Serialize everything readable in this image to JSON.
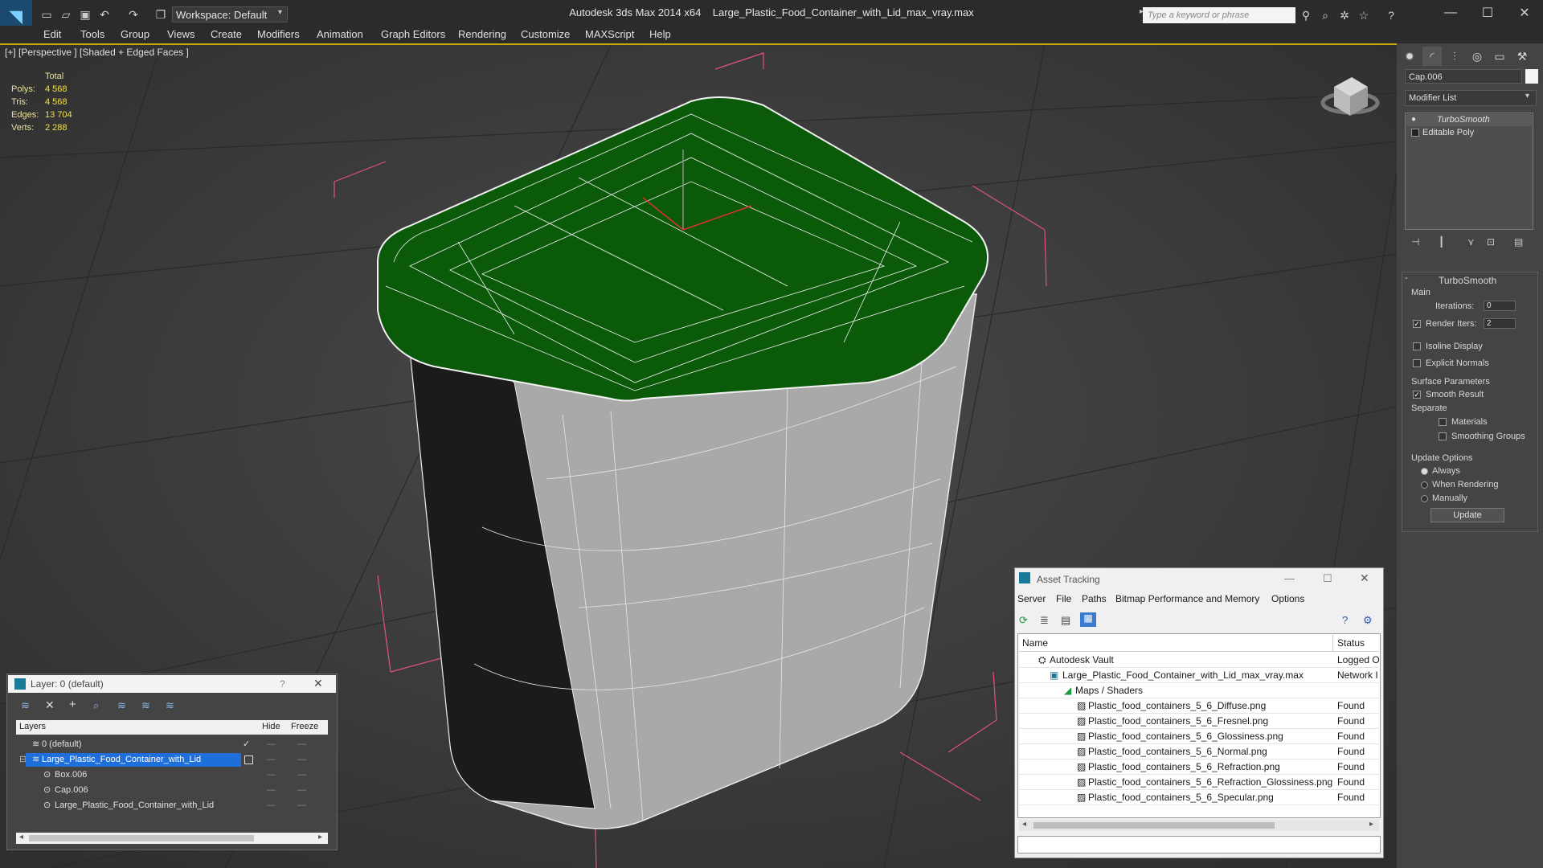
{
  "titlebar": {
    "app": "Autodesk 3ds Max  2014 x64",
    "file": "Large_Plastic_Food_Container_with_Lid_max_vray.max",
    "workspace": "Workspace: Default",
    "search_placeholder": "Type a keyword or phrase"
  },
  "menu": [
    "Edit",
    "Tools",
    "Group",
    "Views",
    "Create",
    "Modifiers",
    "Animation",
    "Graph Editors",
    "Rendering",
    "Customize",
    "MAXScript",
    "Help"
  ],
  "viewport": {
    "label": "[+] [Perspective ] [Shaded + Edged Faces ]",
    "stats": {
      "header": "Total",
      "rows": [
        {
          "label": "Polys:",
          "value": "4 568"
        },
        {
          "label": "Tris:",
          "value": "4 568"
        },
        {
          "label": "Edges:",
          "value": "13 704"
        },
        {
          "label": "Verts:",
          "value": "2 288"
        }
      ]
    }
  },
  "command_panel": {
    "object_name": "Cap.006",
    "modifier_list": "Modifier List",
    "stack": [
      "TurboSmooth",
      "Editable Poly"
    ],
    "rollout_title": "TurboSmooth",
    "main_group": "Main",
    "iterations_label": "Iterations:",
    "iterations_value": "0",
    "render_iters_label": "Render Iters:",
    "render_iters_value": "2",
    "isoline": "Isoline Display",
    "explicit_normals": "Explicit Normals",
    "surface_group": "Surface Parameters",
    "smooth_result": "Smooth Result",
    "separate": "Separate",
    "materials": "Materials",
    "smoothing_groups": "Smoothing Groups",
    "update_group": "Update Options",
    "always": "Always",
    "when_rendering": "When Rendering",
    "manually": "Manually",
    "update": "Update"
  },
  "asset_tracking": {
    "title": "Asset Tracking",
    "menu": [
      "Server",
      "File",
      "Paths",
      "Bitmap Performance and Memory",
      "Options"
    ],
    "columns": {
      "name": "Name",
      "status": "Status"
    },
    "rows": [
      {
        "name": "Autodesk Vault",
        "status": "Logged O"
      },
      {
        "name": "Large_Plastic_Food_Container_with_Lid_max_vray.max",
        "status": "Network I"
      },
      {
        "name": "Maps / Shaders",
        "status": ""
      },
      {
        "name": "Plastic_food_containers_5_6_Diffuse.png",
        "status": "Found"
      },
      {
        "name": "Plastic_food_containers_5_6_Fresnel.png",
        "status": "Found"
      },
      {
        "name": "Plastic_food_containers_5_6_Glossiness.png",
        "status": "Found"
      },
      {
        "name": "Plastic_food_containers_5_6_Normal.png",
        "status": "Found"
      },
      {
        "name": "Plastic_food_containers_5_6_Refraction.png",
        "status": "Found"
      },
      {
        "name": "Plastic_food_containers_5_6_Refraction_Glossiness.png",
        "status": "Found"
      },
      {
        "name": "Plastic_food_containers_5_6_Specular.png",
        "status": "Found"
      }
    ]
  },
  "layer_panel": {
    "title": "Layer: 0 (default)",
    "help": "?",
    "columns": {
      "layers": "Layers",
      "hide": "Hide",
      "freeze": "Freeze"
    },
    "rows": [
      "0 (default)",
      "Large_Plastic_Food_Container_with_Lid",
      "Box.006",
      "Cap.006",
      "Large_Plastic_Food_Container_with_Lid"
    ]
  },
  "colors": {
    "lid_green": "#0a5a0a",
    "selection_blue": "#1e6fd9",
    "bbox_pink": "#e0508a",
    "stat_yellow": "#f0e050"
  }
}
